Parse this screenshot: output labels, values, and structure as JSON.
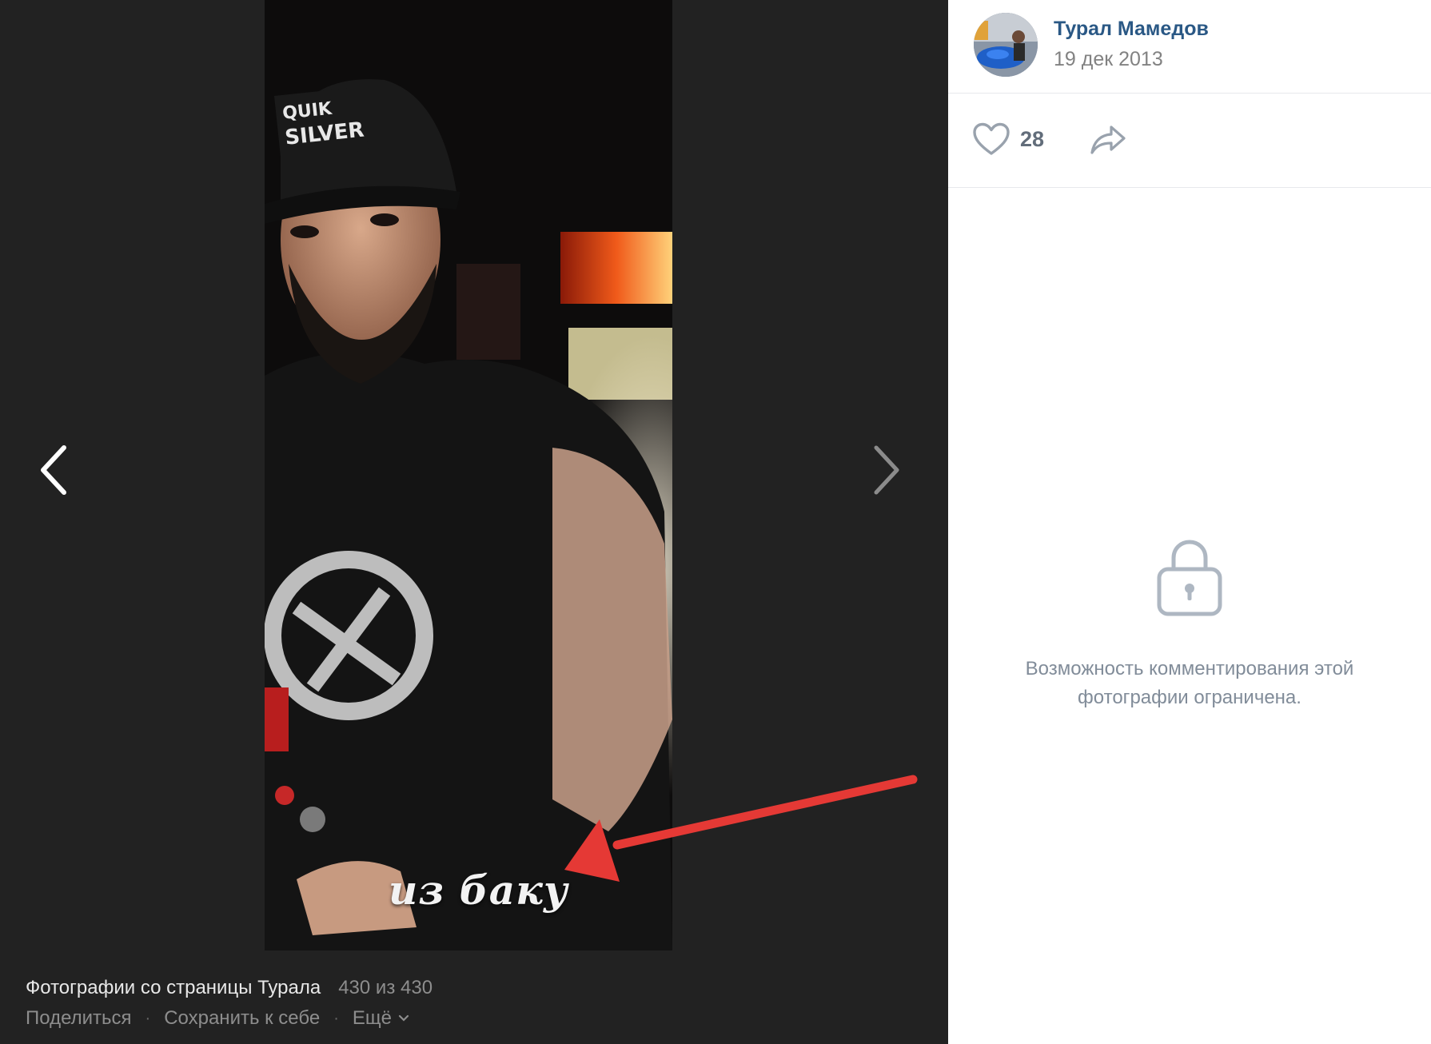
{
  "viewer": {
    "photo_caption": "из баку",
    "album_title": "Фотографии со страницы Турала",
    "counter": "430 из 430",
    "actions": {
      "share": "Поделиться",
      "save": "Сохранить к себе",
      "more": "Ещё"
    },
    "icons": {
      "prev": "chevron-left-icon",
      "next": "chevron-right-icon",
      "more": "chevron-down-icon"
    }
  },
  "side": {
    "author_name": "Турал Мамедов",
    "date": "19 дек 2013",
    "likes": "28",
    "comments_locked_text": "Возможность комментирования этой фотографии ограничена.",
    "icons": {
      "like": "heart-icon",
      "share": "share-arrow-icon",
      "lock": "lock-icon"
    }
  },
  "colors": {
    "viewer_bg": "#222222",
    "link": "#2a5885",
    "annotation_arrow": "#e53935"
  }
}
